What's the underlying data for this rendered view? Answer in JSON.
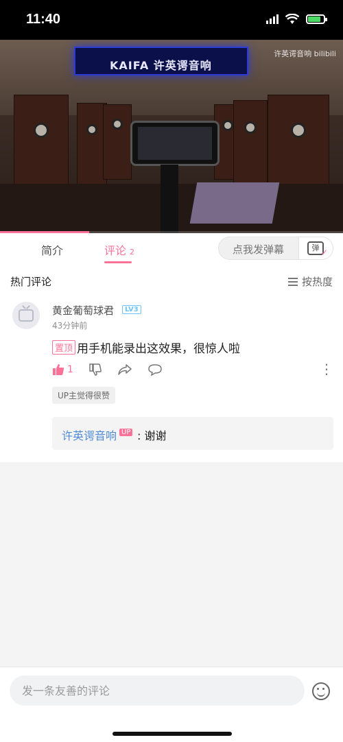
{
  "status_bar": {
    "time": "11:40",
    "battery_charging": true,
    "battery_color": "#4cd964"
  },
  "video": {
    "sign_text": "KAIFA 许英谔音响",
    "watermark": "许英谔音响 bilibili",
    "progress": 0.26,
    "progress_color": "#fb7299"
  },
  "tabs": {
    "intro_label": "简介",
    "comments_label": "评论",
    "comments_count": "2",
    "active": "comments",
    "accent_color": "#fb7299"
  },
  "danmaku": {
    "placeholder": "点我发弹幕",
    "toggle_icon_text": "弹"
  },
  "comments_section": {
    "title": "热门评论",
    "sort_label": "按热度",
    "comments": [
      {
        "username": "黄金葡萄球君",
        "level": "LV3",
        "time": "43分钟前",
        "pinned_label": "置顶",
        "text": "用手机能录出这效果，很惊人啦",
        "like_count": "1",
        "up_liked_label": "UP主觉得很赞",
        "reply": {
          "username": "许英谔音响",
          "badge": "UP",
          "text": ": 谢谢"
        }
      }
    ]
  },
  "bottom_bar": {
    "placeholder": "发一条友善的评论"
  }
}
